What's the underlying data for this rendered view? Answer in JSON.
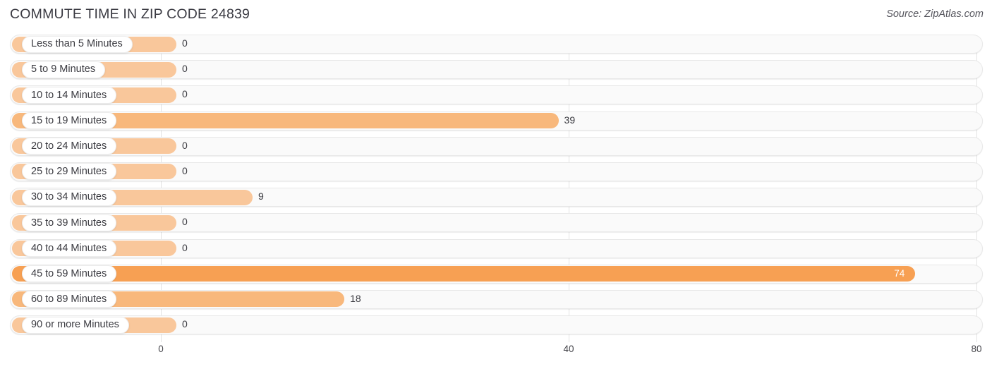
{
  "header": {
    "title": "COMMUTE TIME IN ZIP CODE 24839",
    "source": "Source: ZipAtlas.com"
  },
  "axis": {
    "ticks": [
      {
        "label": "0",
        "value": 0
      },
      {
        "label": "40",
        "value": 40
      },
      {
        "label": "80",
        "value": 80
      }
    ],
    "min": 0,
    "max": 80
  },
  "colors": {
    "bar_light": "#f9c79b",
    "bar_mid": "#f8b87c",
    "bar_strong": "#f7a053",
    "track": "#fafafa",
    "gridline": "#e2e2e2",
    "text": "#3b3b41"
  },
  "chart_data": {
    "type": "bar",
    "orientation": "horizontal",
    "title": "COMMUTE TIME IN ZIP CODE 24839",
    "xlabel": "",
    "ylabel": "",
    "xlim": [
      0,
      80
    ],
    "grid": true,
    "legend": false,
    "source": "Source: ZipAtlas.com",
    "categories": [
      "Less than 5 Minutes",
      "5 to 9 Minutes",
      "10 to 14 Minutes",
      "15 to 19 Minutes",
      "20 to 24 Minutes",
      "25 to 29 Minutes",
      "30 to 34 Minutes",
      "35 to 39 Minutes",
      "40 to 44 Minutes",
      "45 to 59 Minutes",
      "60 to 89 Minutes",
      "90 or more Minutes"
    ],
    "values": [
      0,
      0,
      0,
      39,
      0,
      0,
      9,
      0,
      0,
      74,
      18,
      0
    ]
  },
  "rows": [
    {
      "label": "Less than 5 Minutes",
      "value_text": "0",
      "value": 0,
      "style": "light",
      "inside": false
    },
    {
      "label": "5 to 9 Minutes",
      "value_text": "0",
      "value": 0,
      "style": "light",
      "inside": false
    },
    {
      "label": "10 to 14 Minutes",
      "value_text": "0",
      "value": 0,
      "style": "light",
      "inside": false
    },
    {
      "label": "15 to 19 Minutes",
      "value_text": "39",
      "value": 39,
      "style": "mid",
      "inside": false
    },
    {
      "label": "20 to 24 Minutes",
      "value_text": "0",
      "value": 0,
      "style": "light",
      "inside": false
    },
    {
      "label": "25 to 29 Minutes",
      "value_text": "0",
      "value": 0,
      "style": "light",
      "inside": false
    },
    {
      "label": "30 to 34 Minutes",
      "value_text": "9",
      "value": 9,
      "style": "light",
      "inside": false
    },
    {
      "label": "35 to 39 Minutes",
      "value_text": "0",
      "value": 0,
      "style": "light",
      "inside": false
    },
    {
      "label": "40 to 44 Minutes",
      "value_text": "0",
      "value": 0,
      "style": "light",
      "inside": false
    },
    {
      "label": "45 to 59 Minutes",
      "value_text": "74",
      "value": 74,
      "style": "strong",
      "inside": true
    },
    {
      "label": "60 to 89 Minutes",
      "value_text": "18",
      "value": 18,
      "style": "mid",
      "inside": false
    },
    {
      "label": "90 or more Minutes",
      "value_text": "0",
      "value": 0,
      "style": "light",
      "inside": false
    }
  ]
}
